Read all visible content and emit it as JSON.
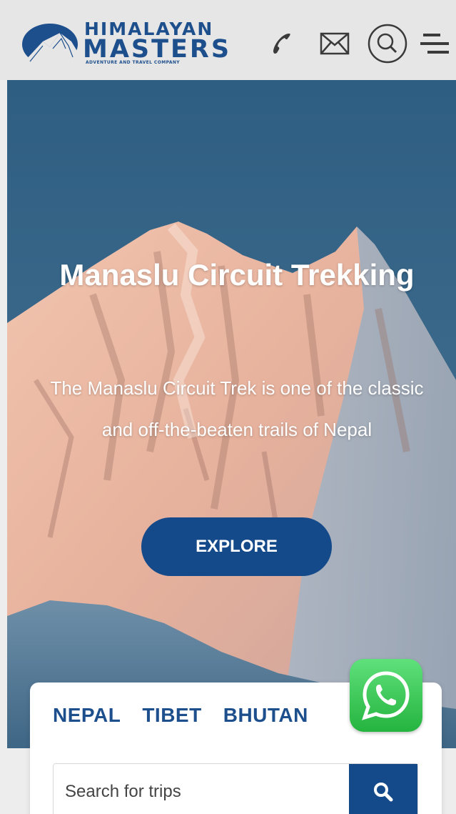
{
  "brand": {
    "line1": "HIMALAYAN",
    "line2": "MASTERS",
    "tagline": "ADVENTURE AND TRAVEL COMPANY",
    "color": "#1d4f8d"
  },
  "header_icons": [
    "phone-icon",
    "mail-icon",
    "search-icon",
    "menu-icon"
  ],
  "hero": {
    "title": "Manaslu Circuit Trekking",
    "subtitle": "The Manaslu Circuit Trek is one of the classic and off-the-beaten trails of Nepal",
    "button_label": "EXPLORE",
    "button_color": "#154a8a"
  },
  "search_card": {
    "tabs": [
      "NEPAL",
      "TIBET",
      "BHUTAN"
    ],
    "placeholder": "Search for trips"
  },
  "whatsapp": {
    "icon": "whatsapp-icon",
    "color": "#25b43f"
  }
}
